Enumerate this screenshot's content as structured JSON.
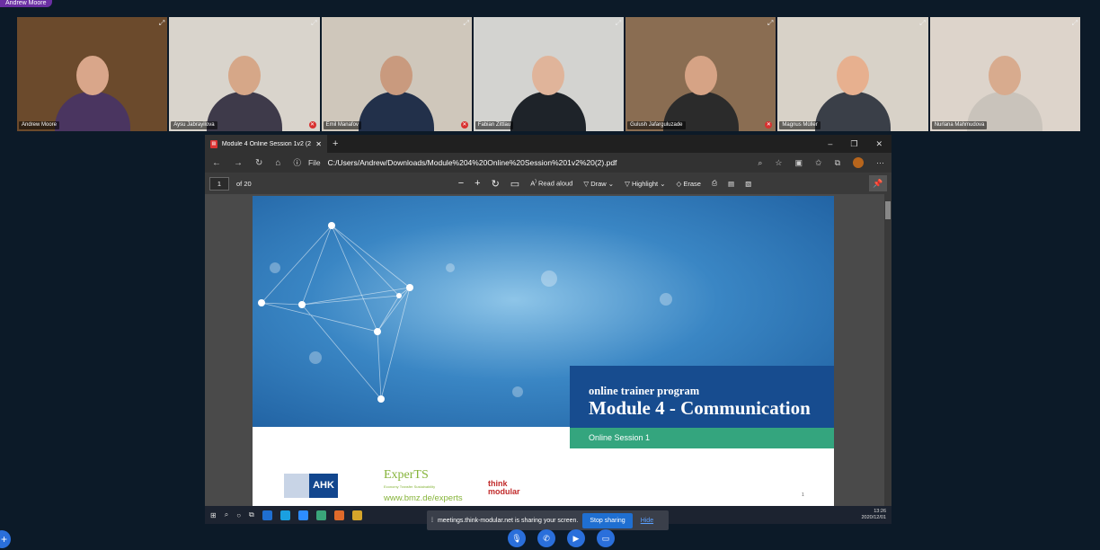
{
  "presenter": "Andrew Moore",
  "participants": [
    {
      "name": "Andrew Moore",
      "bg": "#6b4a2c",
      "skin": "#d9a68a",
      "shirt": "#4a3560",
      "active": true,
      "muted": false
    },
    {
      "name": "Aysu Jabrayilova",
      "bg": "#d9d4cc",
      "skin": "#d6a788",
      "shirt": "#3e3a4a",
      "active": false,
      "muted": true
    },
    {
      "name": "Emil Manafov",
      "bg": "#cfc7bb",
      "skin": "#c99a7e",
      "shirt": "#22304a",
      "active": false,
      "muted": true
    },
    {
      "name": "Fabian Zittlau",
      "bg": "#d3d3d0",
      "skin": "#e0b49a",
      "shirt": "#1e2329",
      "active": false,
      "muted": false
    },
    {
      "name": "Gulush Jafarguluzade",
      "bg": "#8a6d52",
      "skin": "#d6a385",
      "shirt": "#2b2b2b",
      "active": false,
      "muted": true
    },
    {
      "name": "Magnus Müller",
      "bg": "#d8d2c8",
      "skin": "#e7b08f",
      "shirt": "#3a3f48",
      "active": false,
      "muted": false
    },
    {
      "name": "Nurlana Mahmudova",
      "bg": "#ddd4cb",
      "skin": "#d8ab8e",
      "shirt": "#c9c3bb",
      "active": false,
      "muted": false
    }
  ],
  "browser": {
    "tab_title": "Module 4 Online Session 1v2 (2)",
    "file_label": "File",
    "url": "C:/Users/Andrew/Downloads/Module%204%20Online%20Session%201v2%20(2).pdf"
  },
  "pdf_toolbar": {
    "page": "1",
    "of_pages": "of 20",
    "read_aloud": "Read aloud",
    "draw": "Draw",
    "highlight": "Highlight",
    "erase": "Erase"
  },
  "slide": {
    "subtitle": "online trainer program",
    "title": "Module 4 - Communication",
    "session": "Online Session 1",
    "ahk": "AHK",
    "experts": "ExperTS",
    "experts_sub": "Economy Transfer Sustainability",
    "experts_url": "www.bmz.de/experts",
    "think": "think",
    "modular": "modular",
    "page_number": "1"
  },
  "taskbar": {
    "time": "13:26",
    "date": "2020/12/01"
  },
  "share_bar": {
    "message": "meetings.think-modular.net is sharing your screen.",
    "stop": "Stop sharing",
    "hide": "Hide"
  }
}
